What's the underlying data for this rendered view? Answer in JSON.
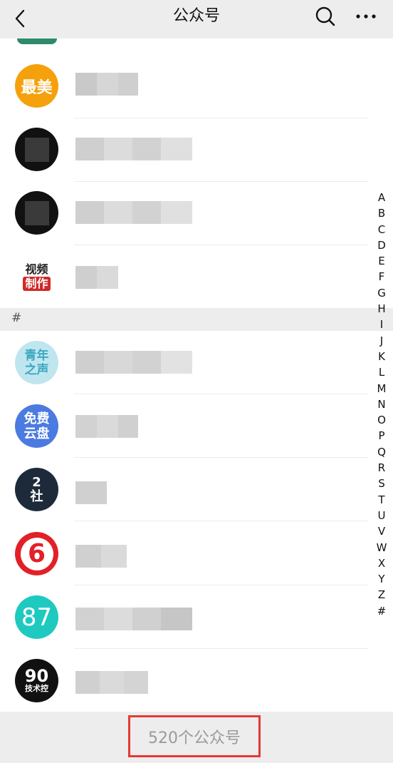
{
  "header": {
    "title": "公众号",
    "back_icon": "chevron-left-icon",
    "search_icon": "search-icon",
    "more_icon": "more-dots-icon"
  },
  "accounts_top": [
    {
      "avatar_text": "最美",
      "avatar_color": "#f5a10c"
    },
    {
      "avatar_text": "",
      "avatar_color": "#111111"
    },
    {
      "avatar_text": "",
      "avatar_color": "#111111"
    },
    {
      "avatar_text_top": "视频",
      "avatar_text_bottom": "制作",
      "avatar_color": "#ffffff"
    }
  ],
  "section_header": "#",
  "accounts_hash": [
    {
      "avatar_text_top": "青年",
      "avatar_text_bottom": "之声",
      "avatar_color": "#bfe6ef"
    },
    {
      "avatar_text_top": "免费",
      "avatar_text_bottom": "云盘",
      "avatar_color": "#4b7be0"
    },
    {
      "avatar_text_top": "2",
      "avatar_text_bottom": "社",
      "avatar_color": "#1d2a3a"
    },
    {
      "avatar_text": "6",
      "avatar_color": "#e32028"
    },
    {
      "avatar_text": "87",
      "avatar_color": "#1ec9c0"
    },
    {
      "avatar_text_top": "90",
      "avatar_text_bottom": "技术控",
      "avatar_color": "#111111"
    }
  ],
  "index_letters": [
    "A",
    "B",
    "C",
    "D",
    "E",
    "F",
    "G",
    "H",
    "I",
    "J",
    "K",
    "L",
    "M",
    "N",
    "O",
    "P",
    "Q",
    "R",
    "S",
    "T",
    "U",
    "V",
    "W",
    "X",
    "Y",
    "Z",
    "#"
  ],
  "footer": {
    "count_label": "520个公众号"
  }
}
